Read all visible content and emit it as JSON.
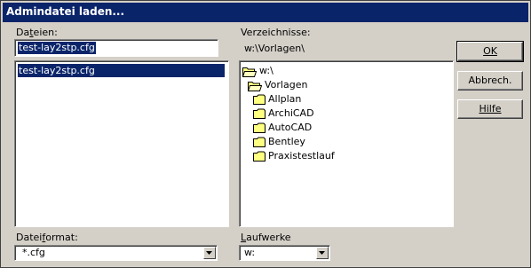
{
  "window": {
    "title": "Admindatei laden..."
  },
  "files": {
    "label_pre": "Da",
    "label_ul": "t",
    "label_post": "eien:",
    "input_value": "test-lay2stp.cfg",
    "list_items": [
      "test-lay2stp.cfg"
    ]
  },
  "directories": {
    "label": "Verzeichnisse:",
    "current_path": "w:\\Vorlagen\\",
    "tree": [
      {
        "label": "w:\\",
        "level": 0,
        "open": true
      },
      {
        "label": "Vorlagen",
        "level": 1,
        "open": true
      },
      {
        "label": "Allplan",
        "level": 2,
        "open": false
      },
      {
        "label": "ArchiCAD",
        "level": 2,
        "open": false
      },
      {
        "label": "AutoCAD",
        "level": 2,
        "open": false
      },
      {
        "label": "Bentley",
        "level": 2,
        "open": false
      },
      {
        "label": "Praxistestlauf",
        "level": 2,
        "open": false
      }
    ]
  },
  "buttons": {
    "ok": "OK",
    "cancel": "Abbrech.",
    "help": "Hilfe"
  },
  "file_format": {
    "label_pre": "Datei",
    "label_ul": "f",
    "label_post": "ormat:",
    "selected": "*.cfg"
  },
  "drives": {
    "label_pre": "",
    "label_ul": "L",
    "label_post": "aufwerke",
    "selected": "w:"
  },
  "colors": {
    "face": "#d4d0c8",
    "selection": "#0a246a",
    "folder": "#ffff80"
  }
}
